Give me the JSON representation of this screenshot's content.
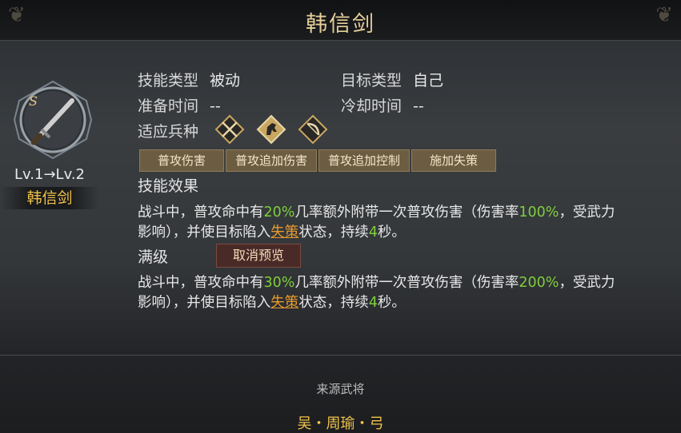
{
  "window": {
    "title": "韩信剑"
  },
  "skill": {
    "grade_letter": "S",
    "level_text": "Lv.1→Lv.2",
    "name": "韩信剑"
  },
  "info": {
    "skill_type_label": "技能类型",
    "skill_type_value": "被动",
    "target_type_label": "目标类型",
    "target_type_value": "自己",
    "prep_time_label": "准备时间",
    "prep_time_value": "--",
    "cooldown_label": "冷却时间",
    "cooldown_value": "--",
    "unit_label": "适应兵种",
    "unit_icons": [
      "crossed-spears-icon",
      "horse-icon",
      "bow-icon"
    ]
  },
  "tags": [
    "普攻伤害",
    "普攻追加伤害",
    "普攻追加控制",
    "施加失策"
  ],
  "effect": {
    "label": "技能效果",
    "line1_a": "战斗中，普攻命中有",
    "line1_pct": "20%",
    "line1_b": "几率额外附带一次普攻伤害（伤害率",
    "line1_rate": "100%",
    "line1_c": "，受武力",
    "line2_a": "影响），并使目标陷入",
    "line2_status": "失策",
    "line2_b": "状态，持续",
    "line2_num": "4",
    "line2_c": "秒。"
  },
  "max_level": {
    "label": "满级",
    "button": "取消预览",
    "line1_a": "战斗中，普攻命中有",
    "line1_pct": "30%",
    "line1_b": "几率额外附带一次普攻伤害（伤害率",
    "line1_rate": "200%",
    "line1_c": "，受武力",
    "line2_a": "影响），并使目标陷入",
    "line2_status": "失策",
    "line2_b": "状态，持续",
    "line2_num": "4",
    "line2_c": "秒。"
  },
  "source": {
    "label": "来源武将",
    "value": "吴・周瑜・弓"
  },
  "colors": {
    "gold": "#f0c24a",
    "highlight_green": "#7fce3c",
    "status_orange": "#e79a2c",
    "tag_bg": "#6c5d42"
  }
}
